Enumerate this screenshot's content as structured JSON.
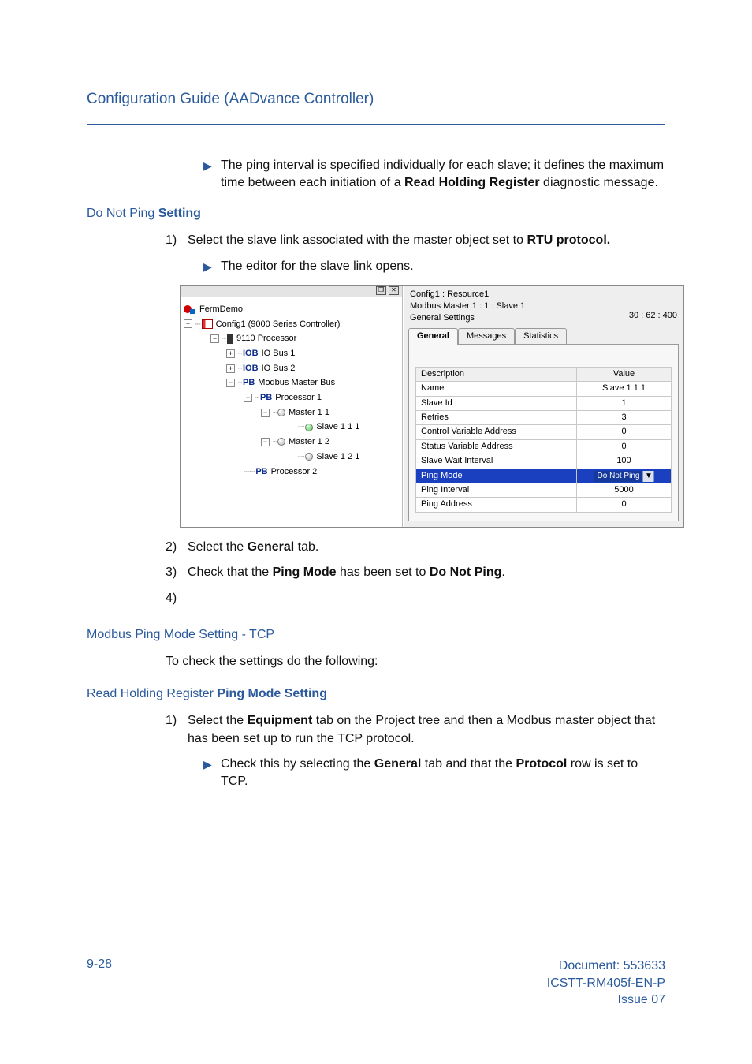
{
  "header": {
    "title": "Configuration Guide (AADvance Controller)"
  },
  "intro_bullet": "The ping interval is specified individually for each slave; it defines the maximum time between each initiation of a ",
  "intro_bullet_bold": "Read Holding Register",
  "intro_bullet_tail": " diagnostic message.",
  "section1": {
    "light": "Do Not Ping ",
    "bold": "Setting"
  },
  "steps1": {
    "1": {
      "pre": "Select the slave link associated with the master object set to ",
      "bold": "RTU protocol."
    },
    "sub": "The editor for the slave link opens.",
    "2": {
      "pre": "Select the ",
      "bold": "General",
      "post": " tab."
    },
    "3": {
      "pre": "Check that the ",
      "bold1": "Ping Mode",
      "mid": " has been set to ",
      "bold2": "Do Not Ping",
      "post": "."
    },
    "4": ""
  },
  "section2": {
    "title": "Modbus Ping Mode Setting - TCP"
  },
  "section2_body": "To check the settings do the following:",
  "section3": {
    "light": "Read Holding Register ",
    "bold": "Ping Mode Setting"
  },
  "steps3": {
    "1": {
      "pre": "Select the ",
      "bold": "Equipment",
      "post": " tab on the Project tree and then a Modbus master object that has been set up to run the TCP protocol."
    },
    "sub": {
      "pre": "Check this by selecting the ",
      "bold1": "General",
      "mid": " tab and that the ",
      "bold2": "Protocol",
      "post": " row is set to TCP."
    }
  },
  "screenshot": {
    "tree": {
      "project": "FermDemo",
      "config": "Config1 (9000 Series Controller)",
      "processor": "9110 Processor",
      "iob1_lbl": "IOB",
      "iob1": "IO Bus 1",
      "iob2_lbl": "IOB",
      "iob2": "IO Bus 2",
      "pb_master_lbl": "PB",
      "pb_master": "Modbus Master Bus",
      "pb_proc1_lbl": "PB",
      "pb_proc1": "Processor 1",
      "m11": "Master 1 1",
      "s111": "Slave 1 1 1",
      "m12": "Master 1 2",
      "s121": "Slave 1 2 1",
      "pb_proc2_lbl": "PB",
      "pb_proc2": "Processor 2"
    },
    "right": {
      "crumb1": "Config1 : Resource1",
      "crumb2": "Modbus Master 1 : 1 : Slave 1",
      "crumb3": "General Settings",
      "counter": "30 : 62 : 400",
      "tabs": {
        "general": "General",
        "messages": "Messages",
        "stats": "Statistics"
      },
      "table": {
        "h1": "Description",
        "h2": "Value",
        "rows": [
          {
            "d": "Name",
            "v": "Slave 1 1 1"
          },
          {
            "d": "Slave Id",
            "v": "1"
          },
          {
            "d": "Retries",
            "v": "3"
          },
          {
            "d": "Control Variable Address",
            "v": "0"
          },
          {
            "d": "Status Variable Address",
            "v": "0"
          },
          {
            "d": "Slave Wait Interval",
            "v": "100"
          },
          {
            "d": "Ping Mode",
            "v": "Do Not Ping",
            "sel": true,
            "dropdown": true
          },
          {
            "d": "Ping Interval",
            "v": "5000"
          },
          {
            "d": "Ping Address",
            "v": "0"
          }
        ]
      }
    }
  },
  "footer": {
    "page": "9-28",
    "doc": "Document: 553633",
    "code": "ICSTT-RM405f-EN-P",
    "issue": "Issue 07"
  }
}
